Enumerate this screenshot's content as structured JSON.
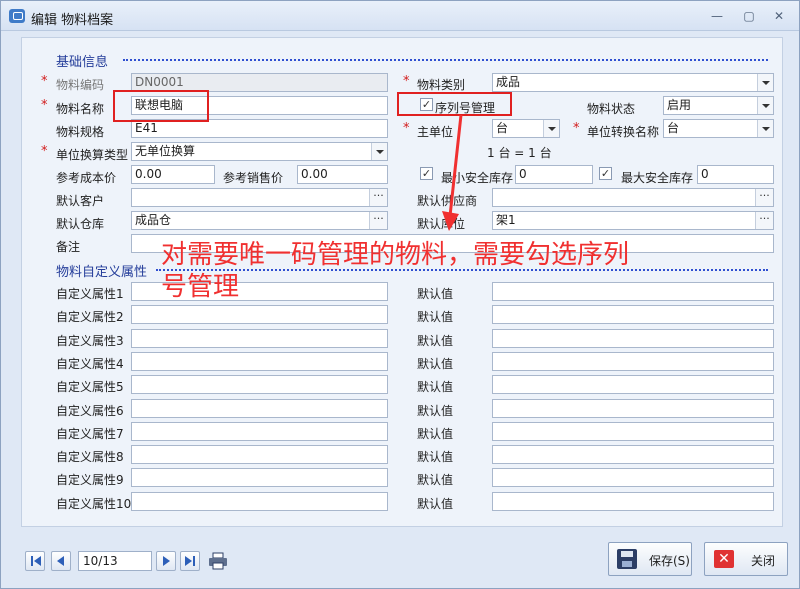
{
  "window": {
    "title": "编辑 物料档案"
  },
  "basic": {
    "section_title": "基础信息",
    "code_label": "物料编码",
    "code_value": "DN0001",
    "category_label": "物料类别",
    "category_value": "成品",
    "name_label": "物料名称",
    "name_value": "联想电脑",
    "serial_label": "序列号管理",
    "serial_checked": true,
    "status_label": "物料状态",
    "status_value": "启用",
    "spec_label": "物料规格",
    "spec_value": "E41",
    "main_unit_label": "主单位",
    "main_unit_value": "台",
    "unit_conv_name_label": "单位转换名称",
    "unit_conv_name_value": "台",
    "conv_type_label": "单位换算类型",
    "conv_type_value": "无单位换算",
    "conv_text": "1 台 = 1 台",
    "cost_label": "参考成本价",
    "cost_value": "0.00",
    "sale_label": "参考销售价",
    "sale_value": "0.00",
    "min_stock_label": "最小安全库存",
    "min_stock_value": "0",
    "max_stock_label": "最大安全库存",
    "max_stock_value": "0",
    "customer_label": "默认客户",
    "customer_value": "",
    "supplier_label": "默认供应商",
    "supplier_value": "",
    "warehouse_label": "默认仓库",
    "warehouse_value": "成品仓",
    "location_label": "默认库位",
    "location_value": "架1",
    "remark_label": "备注",
    "remark_value": ""
  },
  "custom": {
    "section_title": "物料自定义属性",
    "default_label": "默认值",
    "attrs": [
      {
        "label": "自定义属性1",
        "value": "",
        "default": ""
      },
      {
        "label": "自定义属性2",
        "value": "",
        "default": ""
      },
      {
        "label": "自定义属性3",
        "value": "",
        "default": ""
      },
      {
        "label": "自定义属性4",
        "value": "",
        "default": ""
      },
      {
        "label": "自定义属性5",
        "value": "",
        "default": ""
      },
      {
        "label": "自定义属性6",
        "value": "",
        "default": ""
      },
      {
        "label": "自定义属性7",
        "value": "",
        "default": ""
      },
      {
        "label": "自定义属性8",
        "value": "",
        "default": ""
      },
      {
        "label": "自定义属性9",
        "value": "",
        "default": ""
      },
      {
        "label": "自定义属性10",
        "value": "",
        "default": ""
      }
    ]
  },
  "annotation": {
    "line1": "对需要唯一码管理的物料，需要勾选序列",
    "line2": "号管理"
  },
  "footer": {
    "page": "10/13",
    "save_label": "保存(S)",
    "close_label": "关闭"
  },
  "colors": {
    "accent": "#243d9a",
    "required": "#d21a1a",
    "annotation": "#f03030"
  }
}
